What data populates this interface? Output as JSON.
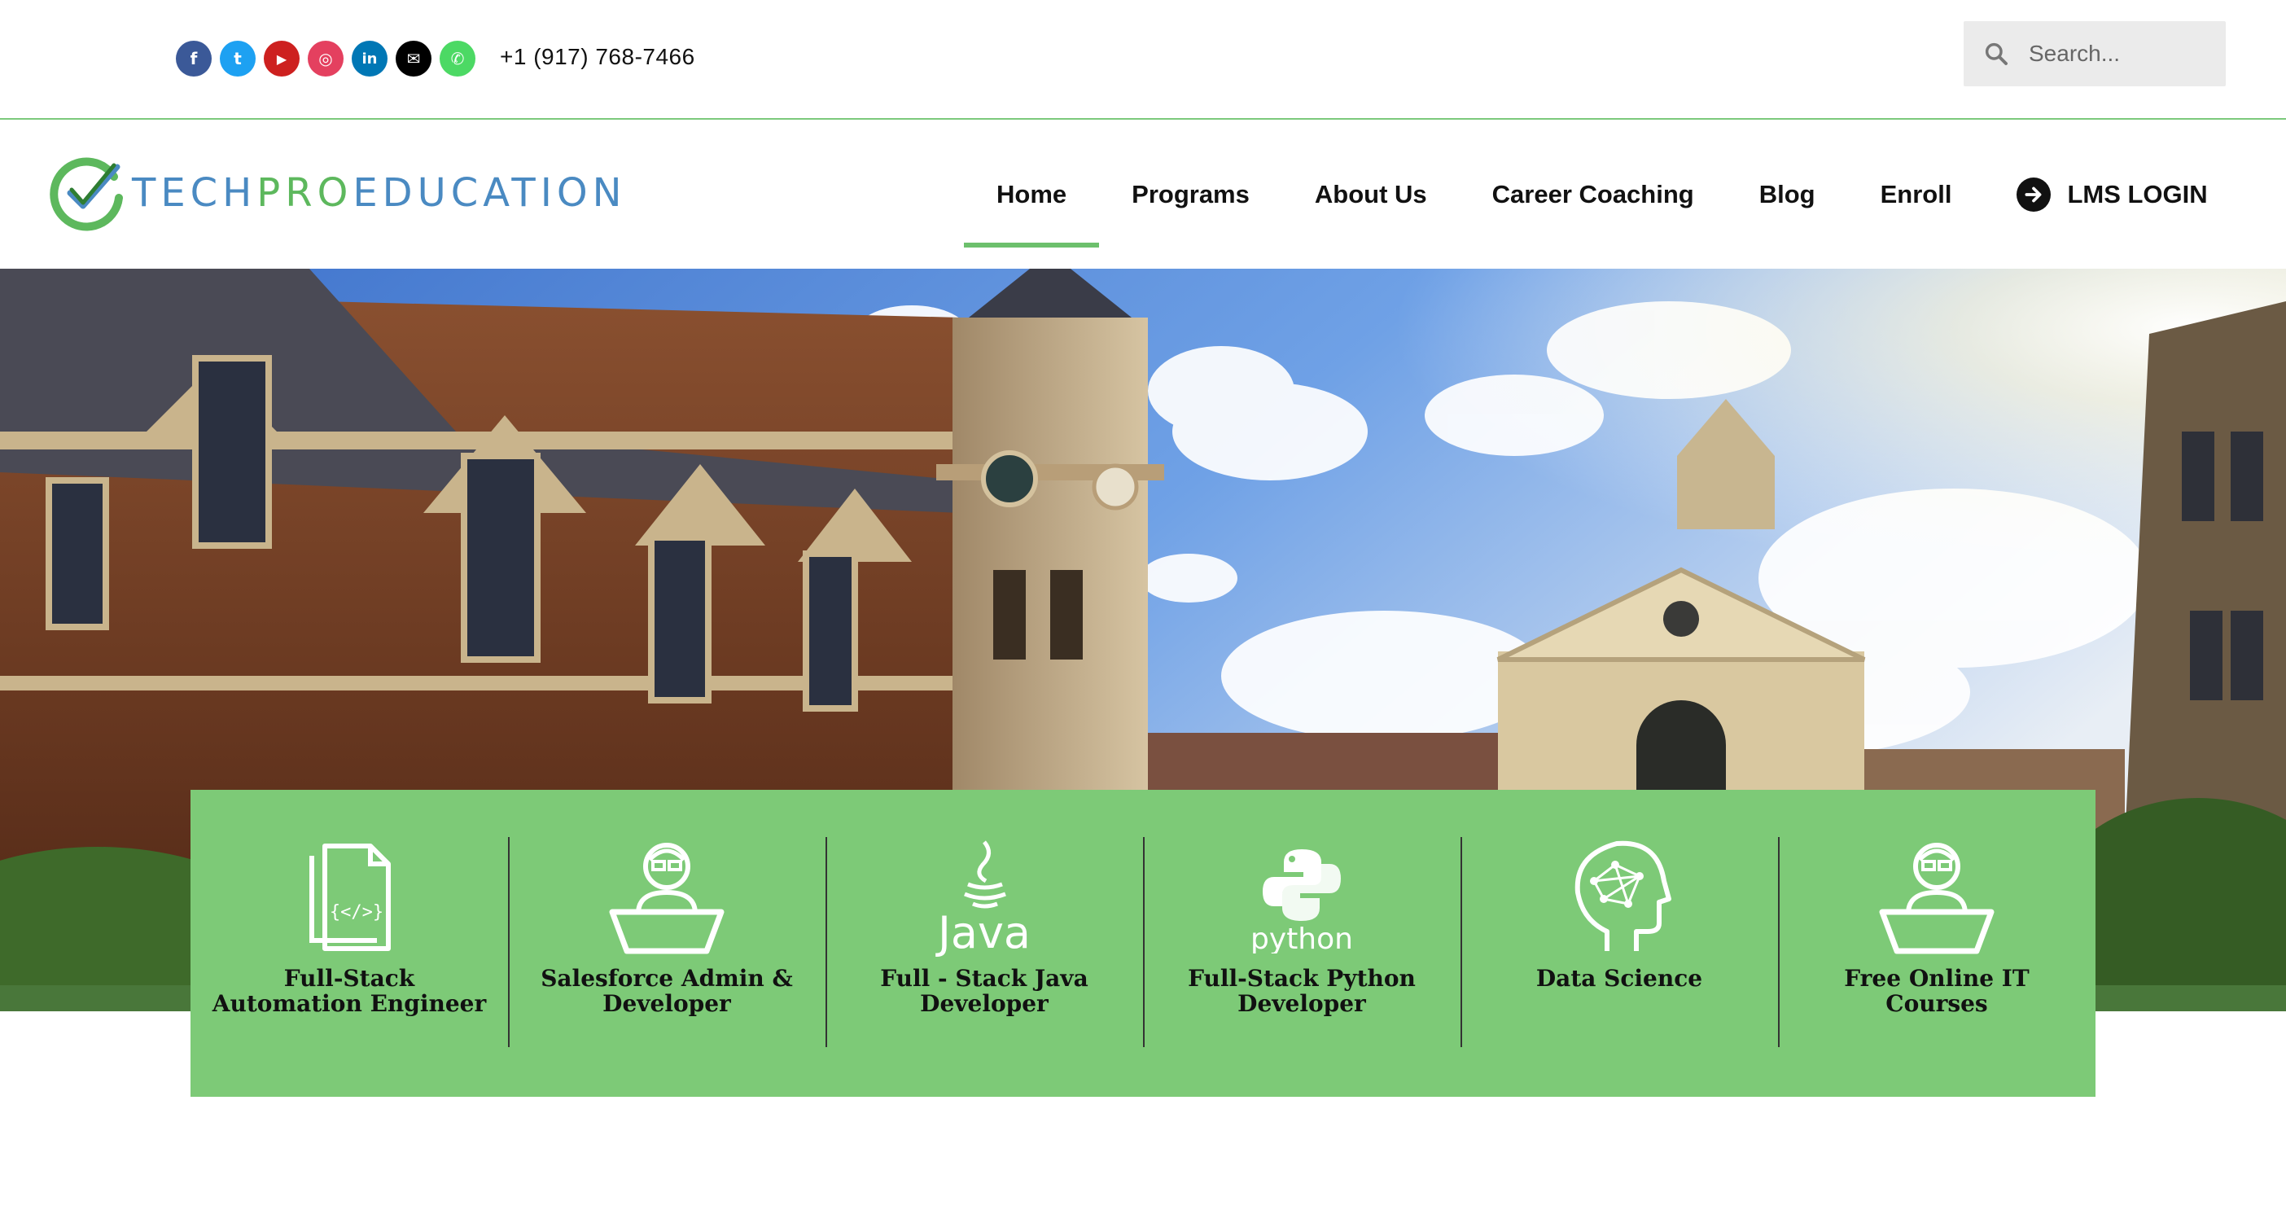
{
  "topbar": {
    "socials": [
      {
        "icon": "facebook-icon",
        "glyph": "f",
        "color": "#3b5998"
      },
      {
        "icon": "twitter-icon",
        "glyph": "t",
        "color": "#1da1f2"
      },
      {
        "icon": "youtube-icon",
        "glyph": "▶",
        "color": "#cd201f"
      },
      {
        "icon": "instagram-icon",
        "glyph": "◎",
        "color": "#e4405f"
      },
      {
        "icon": "linkedin-icon",
        "glyph": "in",
        "color": "#0077b5"
      },
      {
        "icon": "email-icon",
        "glyph": "✉",
        "color": "#000000"
      },
      {
        "icon": "whatsapp-icon",
        "glyph": "✆",
        "color": "#4cd964"
      }
    ],
    "phone": "+1 (917) 768-7466",
    "search_placeholder": "Search..."
  },
  "logo": {
    "part1": "TECH",
    "part2": "PRO",
    "part3": "EDUCATION"
  },
  "nav": {
    "items": [
      "Home",
      "Programs",
      "About Us",
      "Career Coaching",
      "Blog",
      "Enroll"
    ],
    "active": "Home",
    "lms_label": "LMS LOGIN"
  },
  "courses": [
    {
      "icon": "code-document-icon",
      "label": "Full-Stack Automation Engineer"
    },
    {
      "icon": "developer-laptop-icon",
      "label": "Salesforce Admin & Developer"
    },
    {
      "icon": "java-logo-icon",
      "label": "Full - Stack Java Developer"
    },
    {
      "icon": "python-logo-icon",
      "label": "Full-Stack Python Developer"
    },
    {
      "icon": "brain-head-icon",
      "label": "Data Science"
    },
    {
      "icon": "developer-laptop-icon",
      "label": "Free Online IT Courses"
    }
  ],
  "colors": {
    "accent": "#7dca77",
    "nav_underline": "#6cc06c",
    "logo_blue": "#4a8ac2",
    "logo_green": "#5db85d"
  }
}
